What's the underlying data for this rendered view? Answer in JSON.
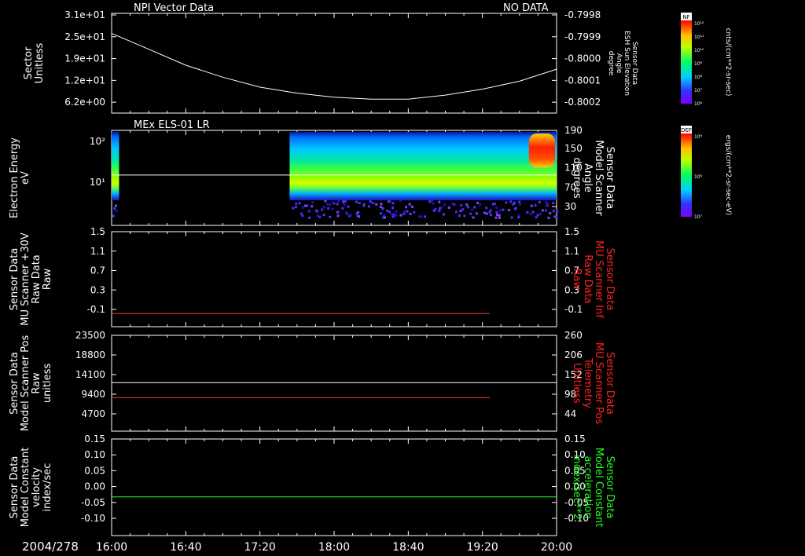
{
  "date_label": "2004/278",
  "x_ticks": [
    "16:00",
    "16:40",
    "17:20",
    "18:00",
    "18:40",
    "19:20",
    "20:00"
  ],
  "panels": [
    {
      "id": "npi",
      "title": "NPI Vector Data",
      "status": "NO DATA",
      "left_label": [
        "Sector",
        "Unitless"
      ],
      "left_ticks": [
        "3.1e+01",
        "2.5e+01",
        "1.9e+01",
        "1.2e+01",
        "6.2e+00"
      ],
      "right_label": [
        "Sensor Data",
        "ESH Sun Elevation",
        "Angle",
        "degree"
      ],
      "right_ticks": [
        "-0.7998",
        "-0.7999",
        "-0.8000",
        "-0.8001",
        "-0.8002"
      ]
    },
    {
      "id": "els",
      "title": "MEx ELS-01 LR",
      "left_label": [
        "Electron Energy",
        "eV"
      ],
      "left_ticks": [
        "10²",
        "10¹"
      ],
      "right_label": [
        "Sensor Data",
        "Model Scanner",
        "Angle",
        "degrees"
      ],
      "right_ticks": [
        "190",
        "150",
        "110",
        "70",
        "30"
      ]
    },
    {
      "id": "mu_inf",
      "left_label": [
        "Sensor Data",
        "MU Scanner +30V",
        "Raw Data",
        "Raw"
      ],
      "left_ticks": [
        "1.5",
        "1.1",
        "0.7",
        "0.3",
        "-0.1"
      ],
      "right_label": [
        "Sensor Data",
        "MU Scanner Inf",
        "Raw Data",
        "Raw"
      ],
      "right_ticks": [
        "1.5",
        "1.1",
        "0.7",
        "0.3",
        "-0.1"
      ]
    },
    {
      "id": "mu_pos",
      "left_label": [
        "Sensor Data",
        "Model Scanner Pos",
        "Raw",
        "unitless"
      ],
      "left_ticks": [
        "23500",
        "18800",
        "14100",
        "9400",
        "4700"
      ],
      "right_label": [
        "Sensor Data",
        "MU Scanner Pos",
        "Telemetry",
        "Unitless"
      ],
      "right_ticks": [
        "260",
        "206",
        "152",
        "98",
        "44"
      ]
    },
    {
      "id": "const",
      "left_label": [
        "Sensor Data",
        "Model Constant",
        "velocity",
        "index/sec"
      ],
      "left_ticks": [
        "0.15",
        "0.10",
        "0.05",
        "0.00",
        "-0.05",
        "-0.10"
      ],
      "right_label": [
        "Sensor Data",
        "Model Constant",
        "acceleration",
        "index/sec**2"
      ],
      "right_ticks": [
        "0.15",
        "0.10",
        "0.05",
        "0.00",
        "-0.05",
        "-0.10"
      ]
    }
  ],
  "colorbars": [
    {
      "top_label": "NF",
      "exponents": [
        "10¹²",
        "10¹¹",
        "10¹⁰",
        "10⁹",
        "10⁸",
        "10⁷",
        "10⁶"
      ],
      "unit": "cnts/(cm**2-sr-sec)"
    },
    {
      "top_label": "DEF",
      "exponents": [
        "10⁹",
        "10⁸",
        "10⁷"
      ],
      "unit": "ergs/(cm**2-sr-sec-eV)"
    }
  ],
  "chart_data": [
    {
      "type": "line",
      "panel": "npi",
      "series": [
        {
          "color": "#ffffff",
          "x": [
            "16:00",
            "16:20",
            "16:40",
            "17:00",
            "17:20",
            "17:40",
            "18:00",
            "18:20",
            "18:40",
            "19:00",
            "19:20",
            "19:40",
            "20:00"
          ],
          "y": [
            -0.79985,
            -0.79993,
            -0.80001,
            -0.80007,
            -0.80012,
            -0.80015,
            -0.80017,
            -0.80018,
            -0.80018,
            -0.80016,
            -0.80013,
            -0.80009,
            -0.80003
          ]
        }
      ],
      "yrange_right": [
        -0.80025,
        -0.79975
      ]
    },
    {
      "type": "heatmap",
      "panel": "els",
      "yscale": "log",
      "ylim": [
        2,
        170
      ],
      "data_blocks": [
        {
          "from": "16:00",
          "to": "16:04"
        },
        {
          "from": "17:36",
          "to": "20:00"
        }
      ],
      "series": [
        {
          "color": "#ffffff",
          "y_right": 95
        }
      ]
    },
    {
      "type": "line",
      "panel": "mu_inf",
      "series": [
        {
          "color": "#ff3030",
          "x": [
            "16:00",
            "19:24"
          ],
          "y": [
            -0.05,
            -0.05
          ]
        }
      ],
      "ylim": [
        -0.3,
        1.5
      ]
    },
    {
      "type": "line",
      "panel": "mu_pos",
      "series": [
        {
          "color": "#ffffff",
          "x": [
            "16:00",
            "20:00"
          ],
          "y": [
            11900,
            11900
          ]
        },
        {
          "color": "#ff3030",
          "x": [
            "16:00",
            "19:24"
          ],
          "y": [
            8200,
            8200
          ]
        }
      ],
      "ylim": [
        0,
        23500
      ]
    },
    {
      "type": "line",
      "panel": "const",
      "series": [
        {
          "color": "#30ff30",
          "x": [
            "16:00",
            "20:00"
          ],
          "y": [
            0,
            0
          ]
        }
      ],
      "ylim": [
        -0.1,
        0.15
      ]
    }
  ]
}
